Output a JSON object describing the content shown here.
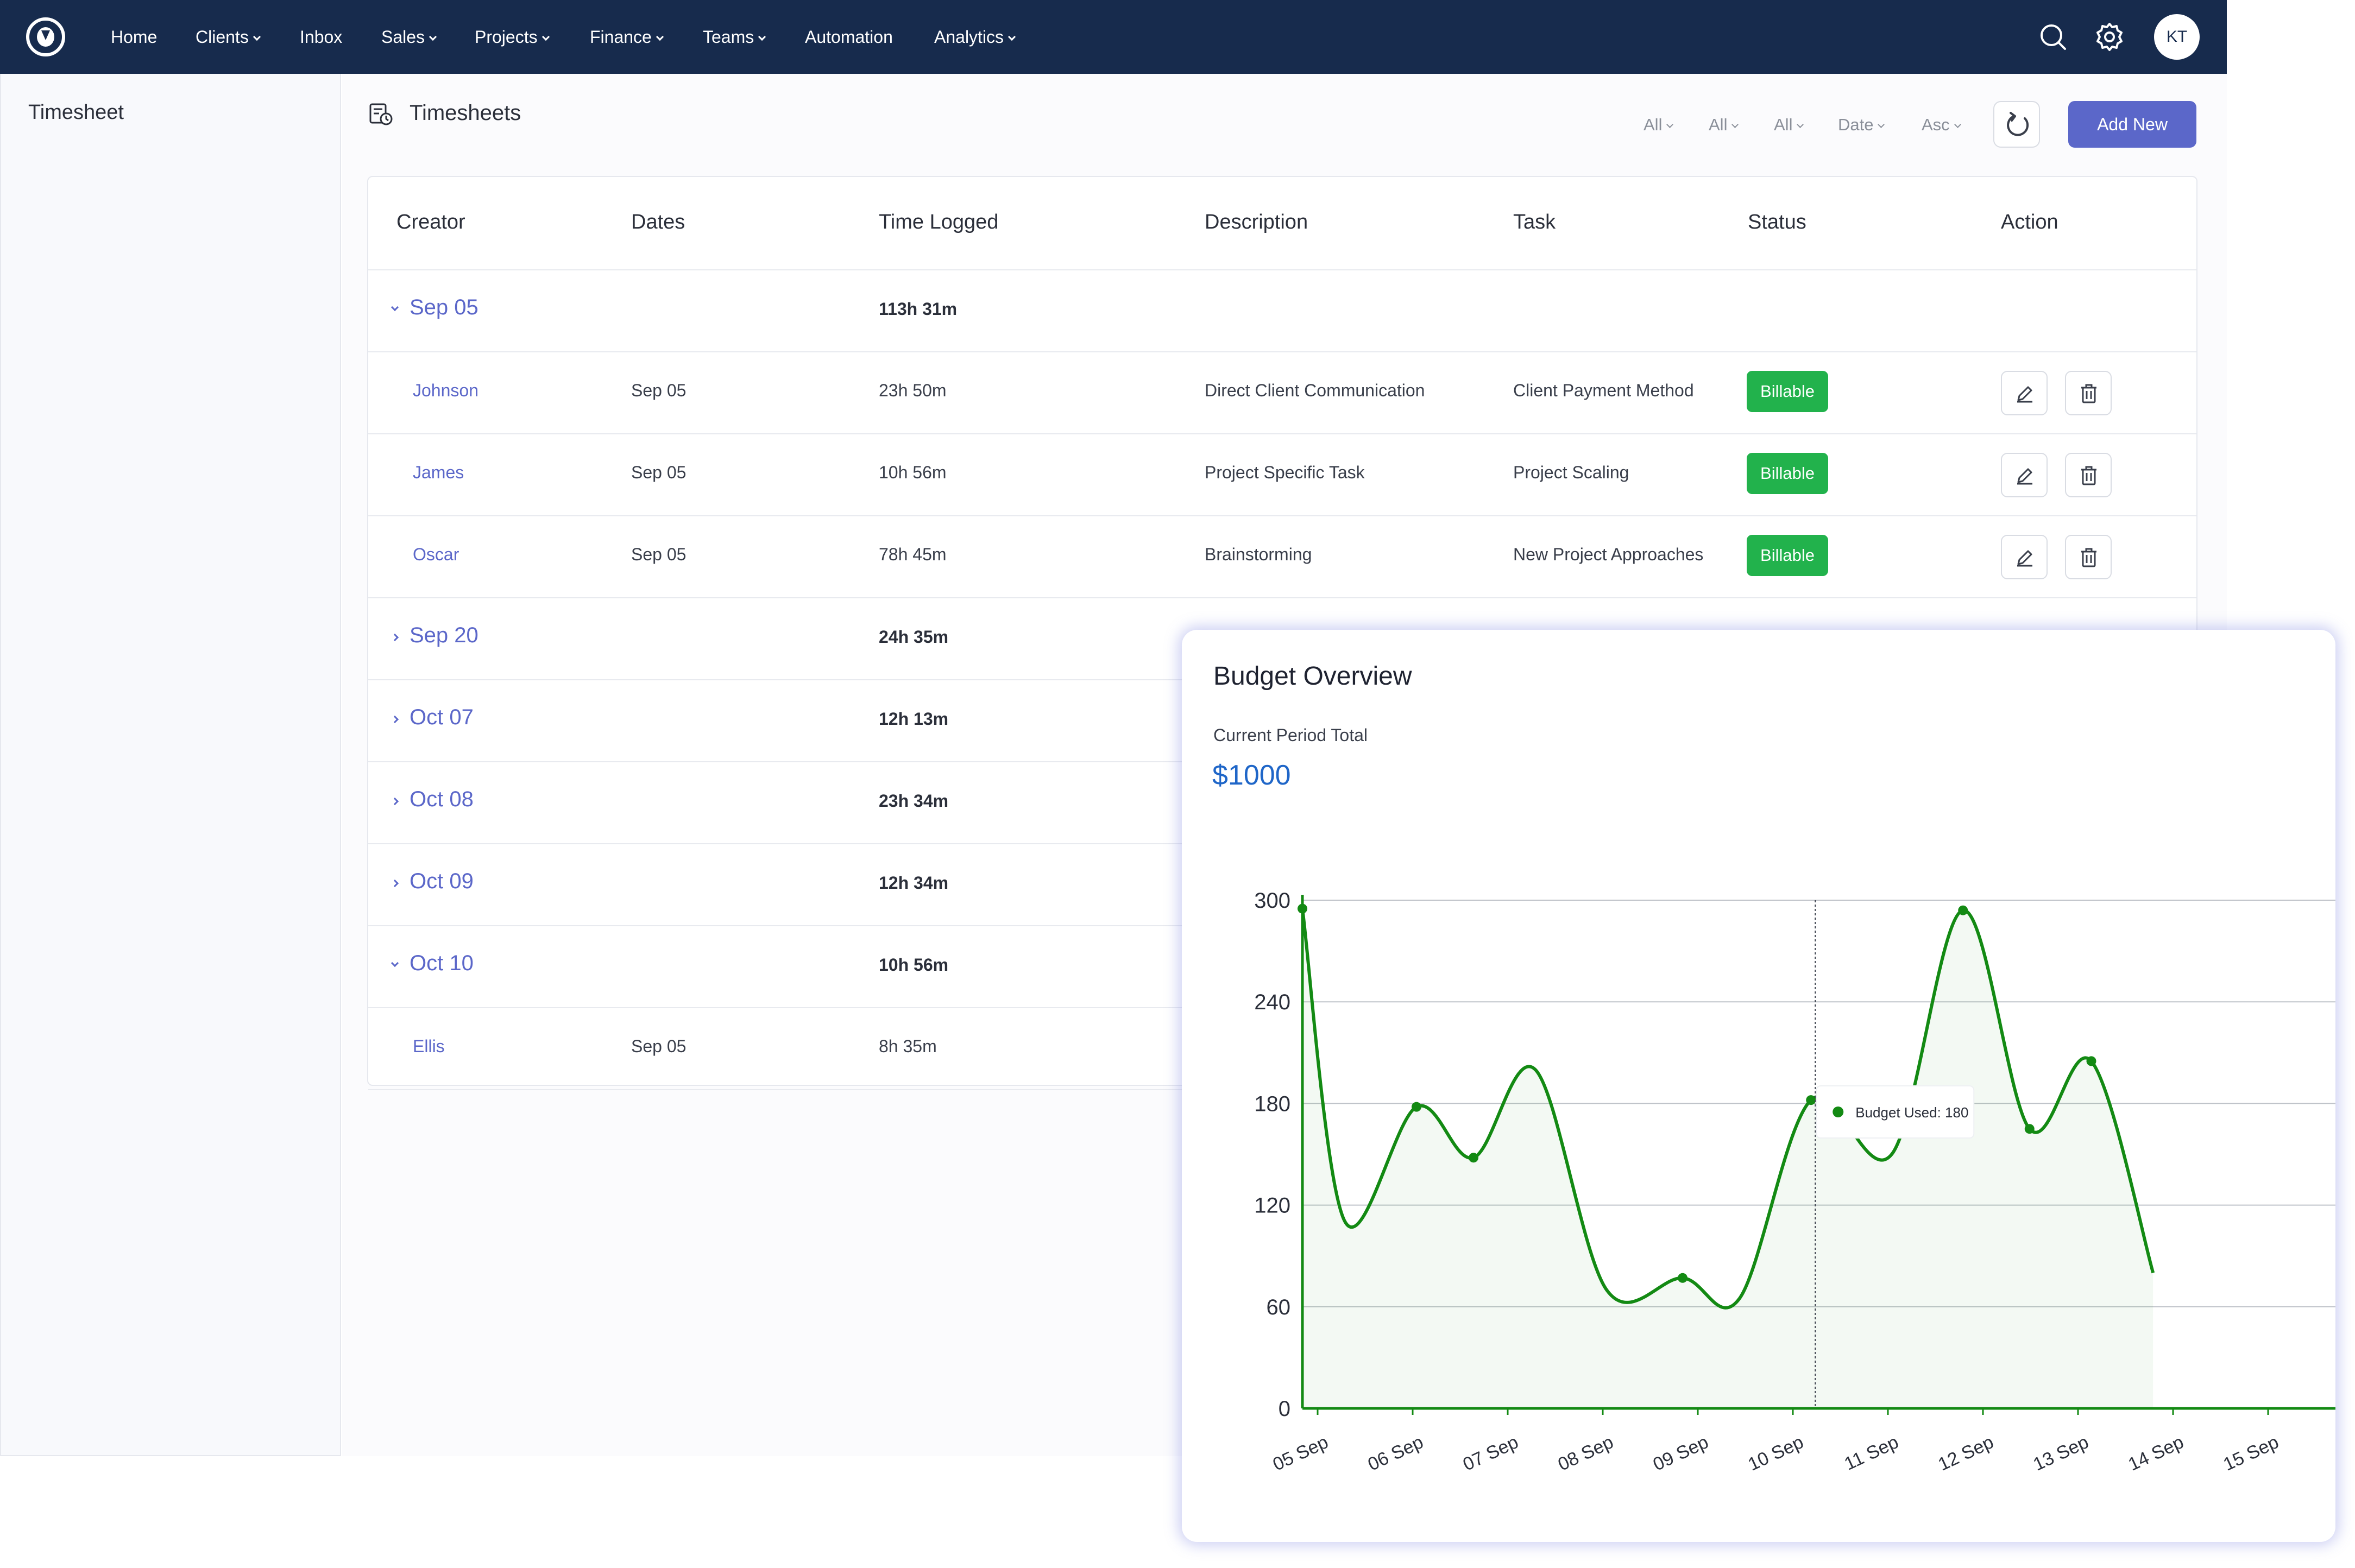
{
  "nav": {
    "items": [
      {
        "label": "Home",
        "dropdown": false
      },
      {
        "label": "Clients",
        "dropdown": true
      },
      {
        "label": "Inbox",
        "dropdown": false
      },
      {
        "label": "Sales",
        "dropdown": true
      },
      {
        "label": "Projects",
        "dropdown": true
      },
      {
        "label": "Finance",
        "dropdown": true
      },
      {
        "label": "Teams",
        "dropdown": true
      },
      {
        "label": "Automation",
        "dropdown": false
      },
      {
        "label": "Analytics",
        "dropdown": true
      }
    ],
    "avatar_initials": "KT",
    "icons": [
      "search-icon",
      "settings-icon"
    ],
    "background": "#172b4d"
  },
  "sidebar": {
    "title": "Timesheet"
  },
  "page": {
    "title": "Timesheets",
    "filters": [
      "All",
      "All",
      "All",
      "Date",
      "Asc"
    ],
    "add_label": "Add New",
    "accent": "#5b67c9"
  },
  "table": {
    "columns": [
      "Creator",
      "Dates",
      "Time Logged",
      "Description",
      "Task",
      "Status",
      "Action"
    ],
    "groups": [
      {
        "label": "Sep 05",
        "total": "113h 31m",
        "expanded": true,
        "rows": [
          {
            "creator": "Johnson",
            "date": "Sep 05",
            "time": "23h 50m",
            "description": "Direct Client Communication",
            "task": "Client Payment Method",
            "status": "Billable"
          },
          {
            "creator": "James",
            "date": "Sep 05",
            "time": "10h 56m",
            "description": "Project Specific Task",
            "task": "Project Scaling",
            "status": "Billable"
          },
          {
            "creator": "Oscar",
            "date": "Sep 05",
            "time": "78h 45m",
            "description": "Brainstorming",
            "task": "New Project Approaches",
            "status": "Billable"
          }
        ]
      },
      {
        "label": "Sep 20",
        "total": "24h 35m",
        "expanded": false,
        "rows": []
      },
      {
        "label": "Oct 07",
        "total": "12h 13m",
        "expanded": false,
        "rows": []
      },
      {
        "label": "Oct 08",
        "total": "23h 34m",
        "expanded": false,
        "rows": []
      },
      {
        "label": "Oct 09",
        "total": "12h 34m",
        "expanded": false,
        "rows": []
      },
      {
        "label": "Oct 10",
        "total": "10h 56m",
        "expanded": true,
        "rows": [
          {
            "creator": "Ellis",
            "date": "Sep 05",
            "time": "8h 35m",
            "description": "",
            "task": "",
            "status": ""
          }
        ]
      }
    ],
    "status_color": "#22b24c"
  },
  "budget": {
    "title": "Budget Overview",
    "subtitle": "Current Period Total",
    "amount": "$1000",
    "tooltip": "Budget Used: 180"
  },
  "chart_data": {
    "type": "area",
    "title": "",
    "xlabel": "",
    "ylabel": "",
    "categories": [
      "05 Sep",
      "06 Sep",
      "07 Sep",
      "08 Sep",
      "09 Sep",
      "10 Sep",
      "11 Sep",
      "12 Sep",
      "13 Sep",
      "14 Sep",
      "15 Sep"
    ],
    "y_ticks": [
      0,
      60,
      120,
      180,
      240,
      300
    ],
    "ylim": [
      0,
      300
    ],
    "series": [
      {
        "points": [
          {
            "x": 0.0,
            "y": 295
          },
          {
            "x": 0.45,
            "y": 110
          },
          {
            "x": 1.2,
            "y": 178
          },
          {
            "x": 1.8,
            "y": 148
          },
          {
            "x": 2.45,
            "y": 200
          },
          {
            "x": 3.2,
            "y": 70
          },
          {
            "x": 4.0,
            "y": 77
          },
          {
            "x": 4.6,
            "y": 65
          },
          {
            "x": 5.35,
            "y": 182
          },
          {
            "x": 6.2,
            "y": 150
          },
          {
            "x": 6.95,
            "y": 294
          },
          {
            "x": 7.65,
            "y": 165
          },
          {
            "x": 8.3,
            "y": 205
          },
          {
            "x": 8.95,
            "y": 80
          }
        ],
        "markers": [
          0,
          2,
          3,
          6,
          8,
          10,
          11,
          12
        ]
      }
    ],
    "hover_x": 5.35,
    "color": "#138a13",
    "grid": true
  }
}
